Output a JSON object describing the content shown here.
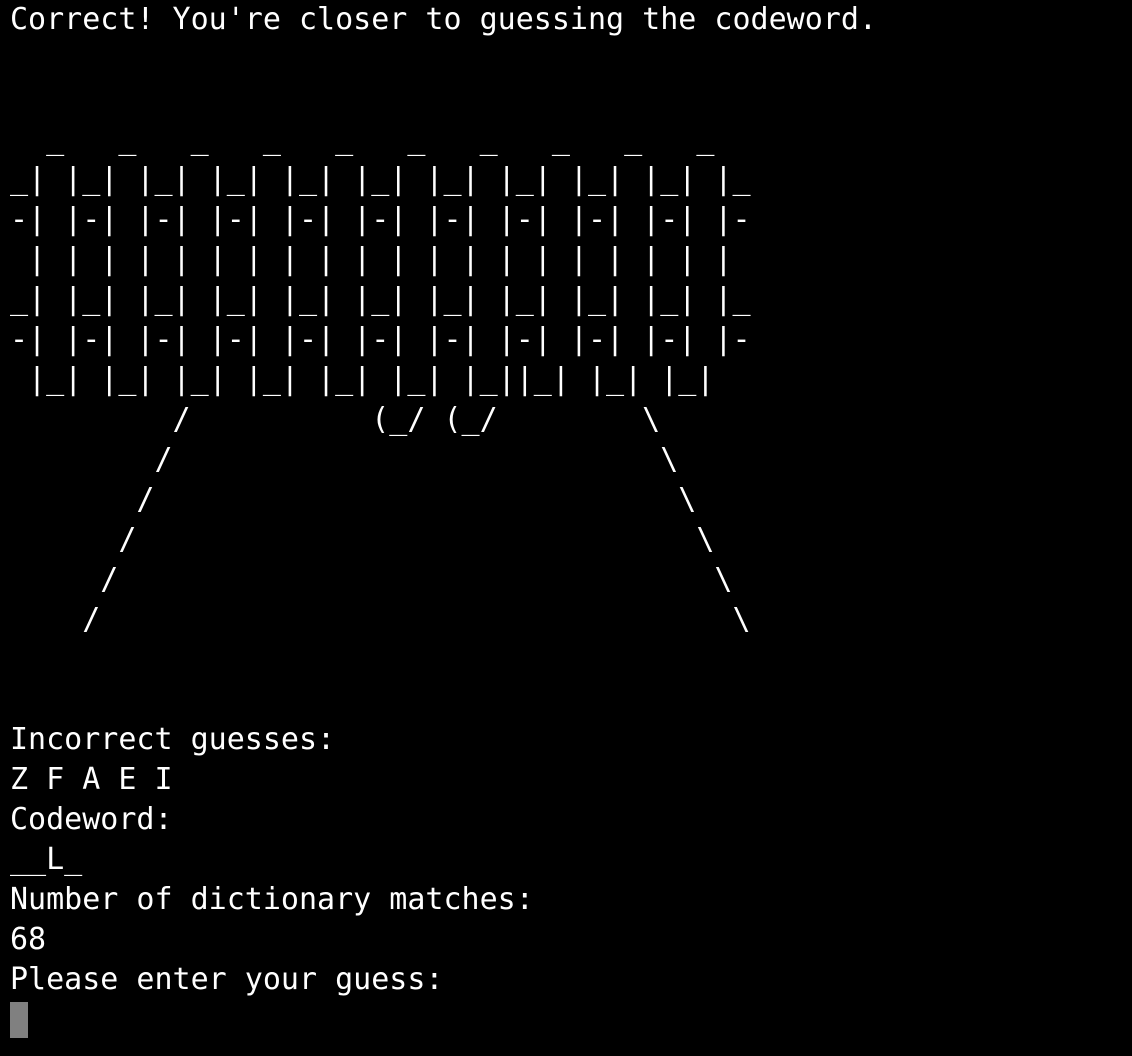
{
  "feedback": "Correct! You're closer to guessing the codeword.",
  "ascii_art": "  _   _   _   _   _   _   _   _   _   _\n_| |_| |_| |_| |_| |_| |_| |_| |_| |_| |_\n-| |-| |-| |-| |-| |-| |-| |-| |-| |-| |-\n | | | | | | | | | | | | | | | | | | | |\n_| |_| |_| |_| |_| |_| |_| |_| |_| |_| |_\n-| |-| |-| |-| |-| |-| |-| |-| |-| |-| |-\n |_| |_| |_| |_| |_| |_| |_||_| |_| |_|\n         /          (_/ (_/        \\\n        /                           \\\n       /                             \\\n      /                               \\\n     /                                 \\\n    /                                   \\",
  "incorrect_label": "Incorrect guesses:",
  "incorrect_letters": "Z F A E I",
  "codeword_label": "Codeword:",
  "codeword_value": "__L_",
  "matches_label": "Number of dictionary matches:",
  "matches_value": "68",
  "prompt": "Please enter your guess:",
  "colors": {
    "background": "#000000",
    "text": "#ffffff",
    "cursor": "#808080"
  }
}
